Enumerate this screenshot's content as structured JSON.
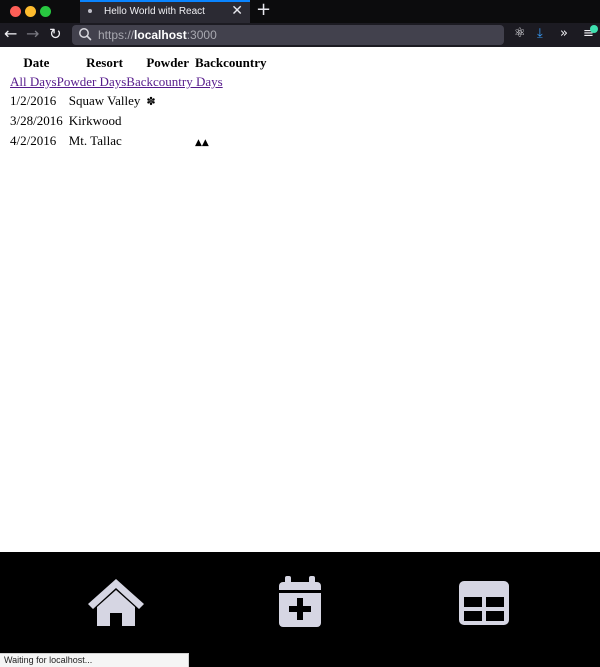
{
  "browser": {
    "tab_title": "Hello World with React",
    "url_scheme": "https://",
    "url_host": "localhost",
    "url_port": ":3000",
    "status_text": "Waiting for localhost..."
  },
  "table": {
    "headers": [
      "Date",
      "Resort",
      "Powder",
      "Backcountry"
    ],
    "filters": [
      "All Days",
      "Powder Days",
      "Backcountry Days"
    ],
    "rows": [
      {
        "date": "1/2/2016",
        "resort": "Squaw Valley",
        "powder": "snowflake-icon",
        "backcountry": ""
      },
      {
        "date": "3/28/2016",
        "resort": "Kirkwood",
        "powder": "",
        "backcountry": ""
      },
      {
        "date": "4/2/2016",
        "resort": "Mt. Tallac",
        "powder": "",
        "backcountry": "mountain-icon"
      }
    ]
  },
  "bottom_nav": {
    "icons": [
      "home-icon",
      "calendar-plus-icon",
      "table-icon"
    ],
    "icon_color": "#d6d6e3"
  }
}
